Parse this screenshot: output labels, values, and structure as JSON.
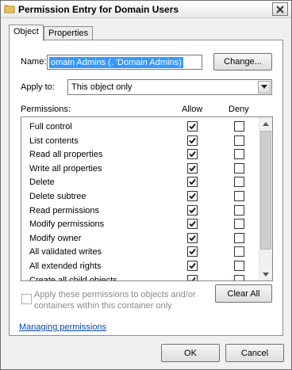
{
  "window": {
    "title": "Permission Entry for Domain Users"
  },
  "tabs": [
    {
      "label": "Object"
    },
    {
      "label": "Properties"
    }
  ],
  "name_field": {
    "label": "Name:",
    "value": "omain Admins (.        'Domain Admins)"
  },
  "change_button": "Change...",
  "apply_to": {
    "label": "Apply to:",
    "value": "This object only"
  },
  "permissions": {
    "label": "Permissions:",
    "allow_header": "Allow",
    "deny_header": "Deny",
    "rows": [
      {
        "name": "Full control",
        "allow": true,
        "deny": false
      },
      {
        "name": "List contents",
        "allow": true,
        "deny": false
      },
      {
        "name": "Read all properties",
        "allow": true,
        "deny": false
      },
      {
        "name": "Write all properties",
        "allow": true,
        "deny": false
      },
      {
        "name": "Delete",
        "allow": true,
        "deny": false
      },
      {
        "name": "Delete subtree",
        "allow": true,
        "deny": false
      },
      {
        "name": "Read permissions",
        "allow": true,
        "deny": false
      },
      {
        "name": "Modify permissions",
        "allow": true,
        "deny": false
      },
      {
        "name": "Modify owner",
        "allow": true,
        "deny": false
      },
      {
        "name": "All validated writes",
        "allow": true,
        "deny": false
      },
      {
        "name": "All extended rights",
        "allow": true,
        "deny": false
      },
      {
        "name": "Create all child objects",
        "allow": true,
        "deny": false
      }
    ]
  },
  "apply_checkbox": {
    "label": "Apply these permissions to objects and/or containers within this container only",
    "checked": false
  },
  "clear_all_button": "Clear All",
  "link": "Managing permissions",
  "ok_button": "OK",
  "cancel_button": "Cancel"
}
